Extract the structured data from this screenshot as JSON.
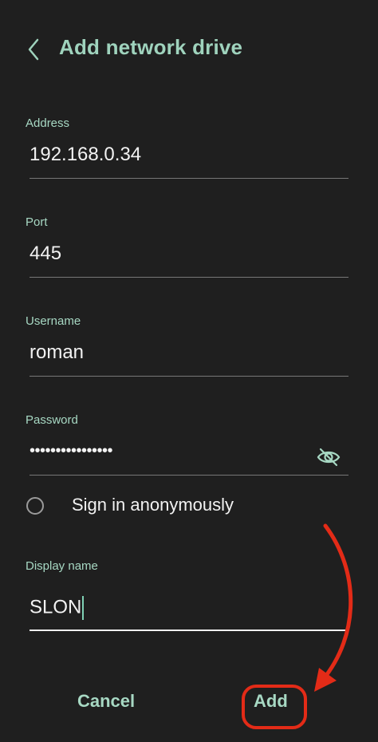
{
  "header": {
    "title": "Add network drive",
    "back_icon": "chevron-left-icon"
  },
  "form": {
    "address": {
      "label": "Address",
      "value": "192.168.0.34"
    },
    "port": {
      "label": "Port",
      "value": "445"
    },
    "username": {
      "label": "Username",
      "value": "roman"
    },
    "password": {
      "label": "Password",
      "masked_value": "••••••••••••••••",
      "toggle_icon": "eye-off-icon"
    },
    "anonymous": {
      "label": "Sign in anonymously",
      "checked": false
    },
    "display_name": {
      "label": "Display name",
      "value": "SLON"
    }
  },
  "actions": {
    "cancel_label": "Cancel",
    "add_label": "Add"
  },
  "colors": {
    "background": "#1f1f1f",
    "accent": "#a7d8c3",
    "annotation": "#e32b17"
  }
}
